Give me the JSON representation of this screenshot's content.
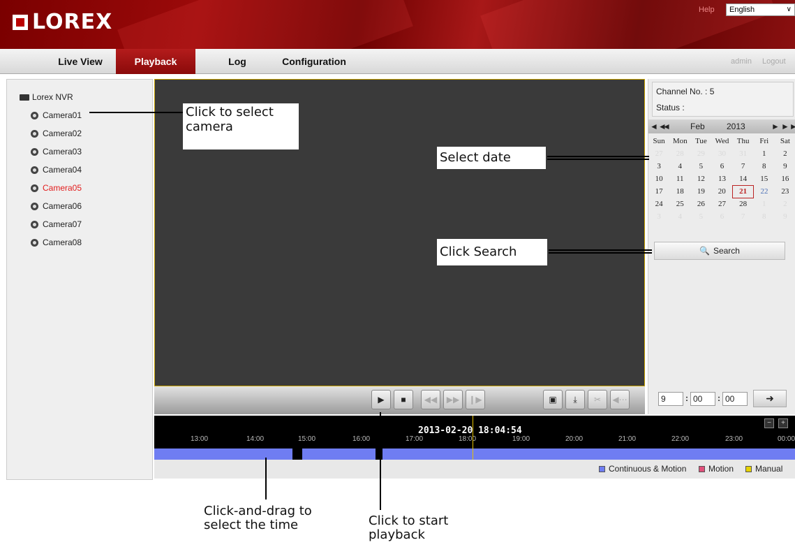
{
  "header": {
    "brand": "LOREX",
    "help": "Help",
    "language": "English"
  },
  "nav": {
    "tabs": [
      {
        "label": "Live View"
      },
      {
        "label": "Playback",
        "active": true
      },
      {
        "label": "Log"
      },
      {
        "label": "Configuration"
      }
    ],
    "user": "admin",
    "logout": "Logout"
  },
  "tree": {
    "root": "Lorex NVR",
    "cameras": [
      "Camera01",
      "Camera02",
      "Camera03",
      "Camera04",
      "Camera05",
      "Camera06",
      "Camera07",
      "Camera08"
    ],
    "selected_camera": "Camera05"
  },
  "channel": {
    "label": "Channel No. : 5",
    "status": "Status :"
  },
  "calendar": {
    "month": "Feb",
    "year": "2013",
    "weekdays": [
      "Sun",
      "Mon",
      "Tue",
      "Wed",
      "Thu",
      "Fri",
      "Sat"
    ],
    "weeks": [
      [
        "27",
        "28",
        "29",
        "30",
        "31",
        "1",
        "2"
      ],
      [
        "3",
        "4",
        "5",
        "6",
        "7",
        "8",
        "9"
      ],
      [
        "10",
        "11",
        "12",
        "13",
        "14",
        "15",
        "16"
      ],
      [
        "17",
        "18",
        "19",
        "20",
        "21",
        "22",
        "23"
      ],
      [
        "24",
        "25",
        "26",
        "27",
        "28",
        "1",
        "2"
      ],
      [
        "3",
        "4",
        "5",
        "6",
        "7",
        "8",
        "9"
      ]
    ],
    "selected_day": "21"
  },
  "search": {
    "label": "Search"
  },
  "time_input": {
    "hour": "9",
    "minute": "00",
    "second": "00"
  },
  "timeline": {
    "current": "2013-02-20 18:04:54",
    "ticks": [
      "13:00",
      "14:00",
      "15:00",
      "16:00",
      "17:00",
      "18:00",
      "19:00",
      "20:00",
      "21:00",
      "22:00",
      "23:00",
      "00:00"
    ],
    "legend": [
      {
        "label": "Continuous & Motion",
        "color": "#6f7df2"
      },
      {
        "label": "Motion",
        "color": "#e0507a"
      },
      {
        "label": "Manual",
        "color": "#e6d200"
      }
    ]
  },
  "controls": [
    "play-icon",
    "stop-icon",
    "slow-icon",
    "fast-icon",
    "frame-step-icon",
    "snapshot-icon",
    "download-icon",
    "clip-icon",
    "volume-icon"
  ],
  "callouts": {
    "select_camera": "Click to select camera",
    "select_date": "Select date",
    "click_search": "Click Search",
    "drag_time": "Click-and-drag to select the time",
    "start_playback": "Click to start playback"
  },
  "colors": {
    "brand_red": "#9c0a0a",
    "selected_red": "#e21c1c",
    "timeline_blue": "#6f7df2",
    "cursor_yellow": "#e6c200"
  }
}
